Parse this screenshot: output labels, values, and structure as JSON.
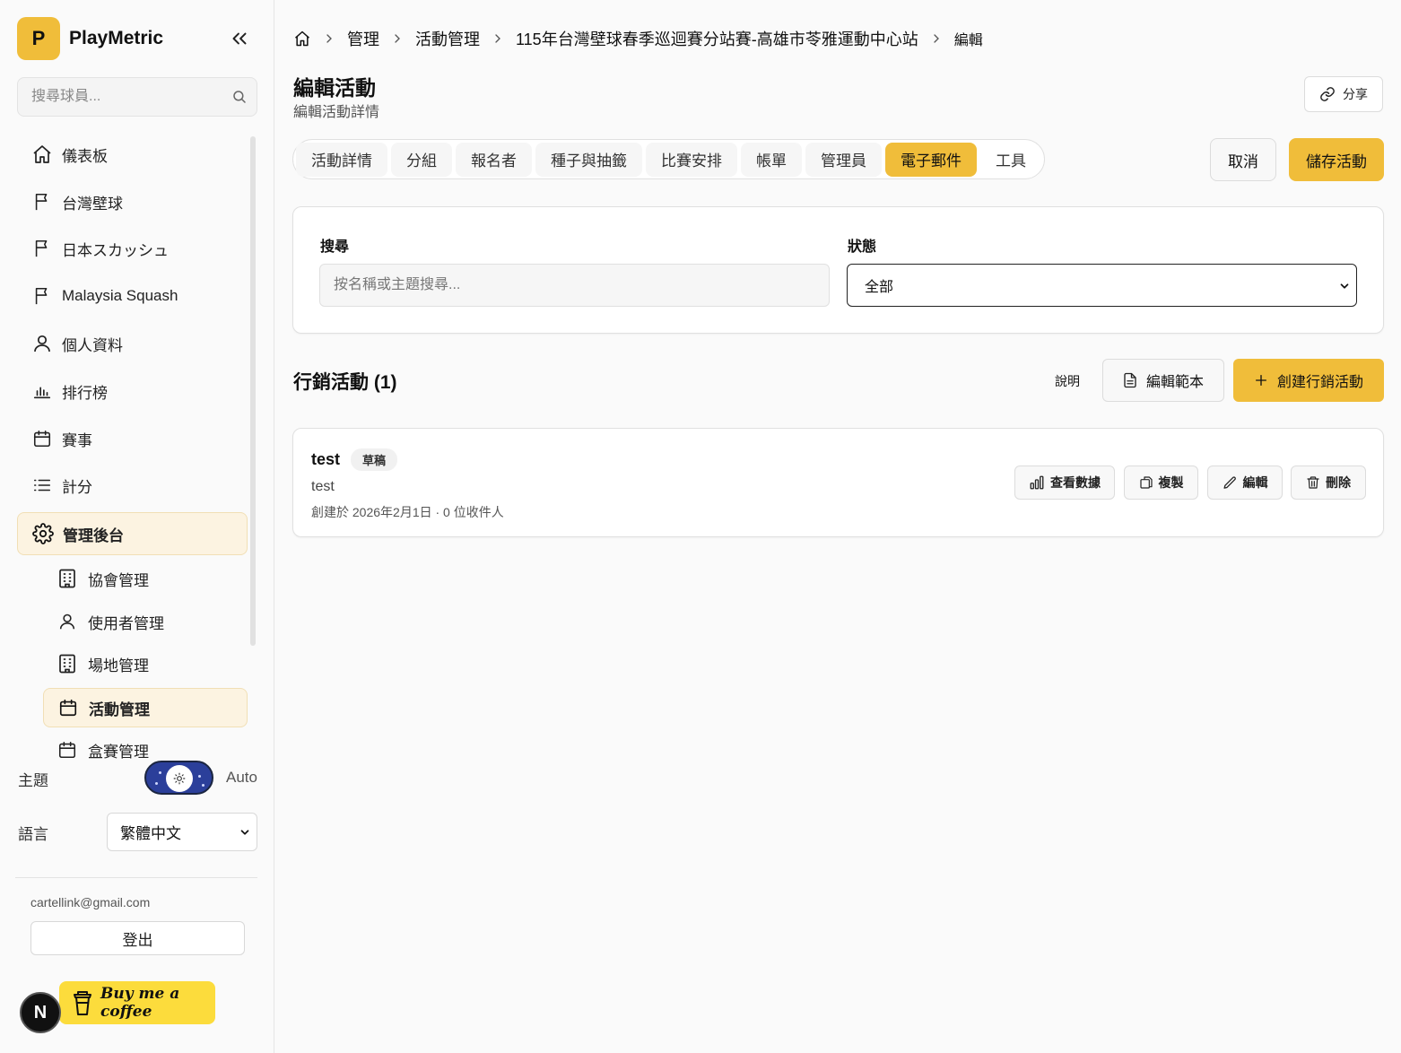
{
  "sidebar": {
    "brand_letter": "P",
    "brand_name": "PlayMetric",
    "search_placeholder": "搜尋球員...",
    "nav": [
      {
        "label": "儀表板",
        "icon": "home-icon"
      },
      {
        "label": "台灣壁球",
        "icon": "flag-icon"
      },
      {
        "label": "日本スカッシュ",
        "icon": "flag-icon"
      },
      {
        "label": "Malaysia Squash",
        "icon": "flag-icon"
      },
      {
        "label": "個人資料",
        "icon": "user-icon"
      },
      {
        "label": "排行榜",
        "icon": "bar-chart-icon"
      },
      {
        "label": "賽事",
        "icon": "calendar-icon"
      },
      {
        "label": "計分",
        "icon": "list-icon"
      },
      {
        "label": "管理後台",
        "icon": "gear-icon"
      }
    ],
    "admin_sub": [
      {
        "label": "協會管理",
        "icon": "building-icon"
      },
      {
        "label": "使用者管理",
        "icon": "user-icon"
      },
      {
        "label": "場地管理",
        "icon": "building-icon"
      },
      {
        "label": "活動管理",
        "icon": "calendar-icon"
      },
      {
        "label": "盒賽管理",
        "icon": "calendar-icon"
      }
    ],
    "theme_label": "主題",
    "theme_value": "Auto",
    "language_label": "語言",
    "language_value": "繁體中文",
    "email": "cartellink@gmail.com",
    "logout_label": "登出",
    "coffee_label": "Buy me a coffee",
    "n_badge": "N"
  },
  "breadcrumb": [
    "管理",
    "活動管理",
    "115年台灣壁球春季巡迴賽分站賽-高雄市苓雅運動中心站",
    "編輯"
  ],
  "header": {
    "title": "編輯活動",
    "subtitle": "編輯活動詳情",
    "share_label": "分享"
  },
  "tabs": [
    "活動詳情",
    "分組",
    "報名者",
    "種子與抽籤",
    "比賽安排",
    "帳單",
    "管理員",
    "電子郵件",
    "工具"
  ],
  "active_tab": "電子郵件",
  "actions": {
    "cancel": "取消",
    "save": "儲存活動"
  },
  "filters": {
    "search_label": "搜尋",
    "search_placeholder": "按名稱或主題搜尋...",
    "status_label": "狀態",
    "status_value": "全部"
  },
  "campaigns_section": {
    "title": "行銷活動 (1)",
    "help": "說明",
    "edit_template": "編輯範本",
    "create": "創建行銷活動"
  },
  "campaigns": [
    {
      "name": "test",
      "status": "草稿",
      "subject": "test",
      "meta": "創建於 2026年2月1日 · 0 位收件人",
      "actions": {
        "stats": "查看數據",
        "copy": "複製",
        "edit": "編輯",
        "delete": "刪除"
      }
    }
  ],
  "colors": {
    "accent": "#f0bd3a",
    "active_bg": "#fcf3e1",
    "coffee": "#fcdc3c",
    "toggle": "#2b3f9a"
  }
}
